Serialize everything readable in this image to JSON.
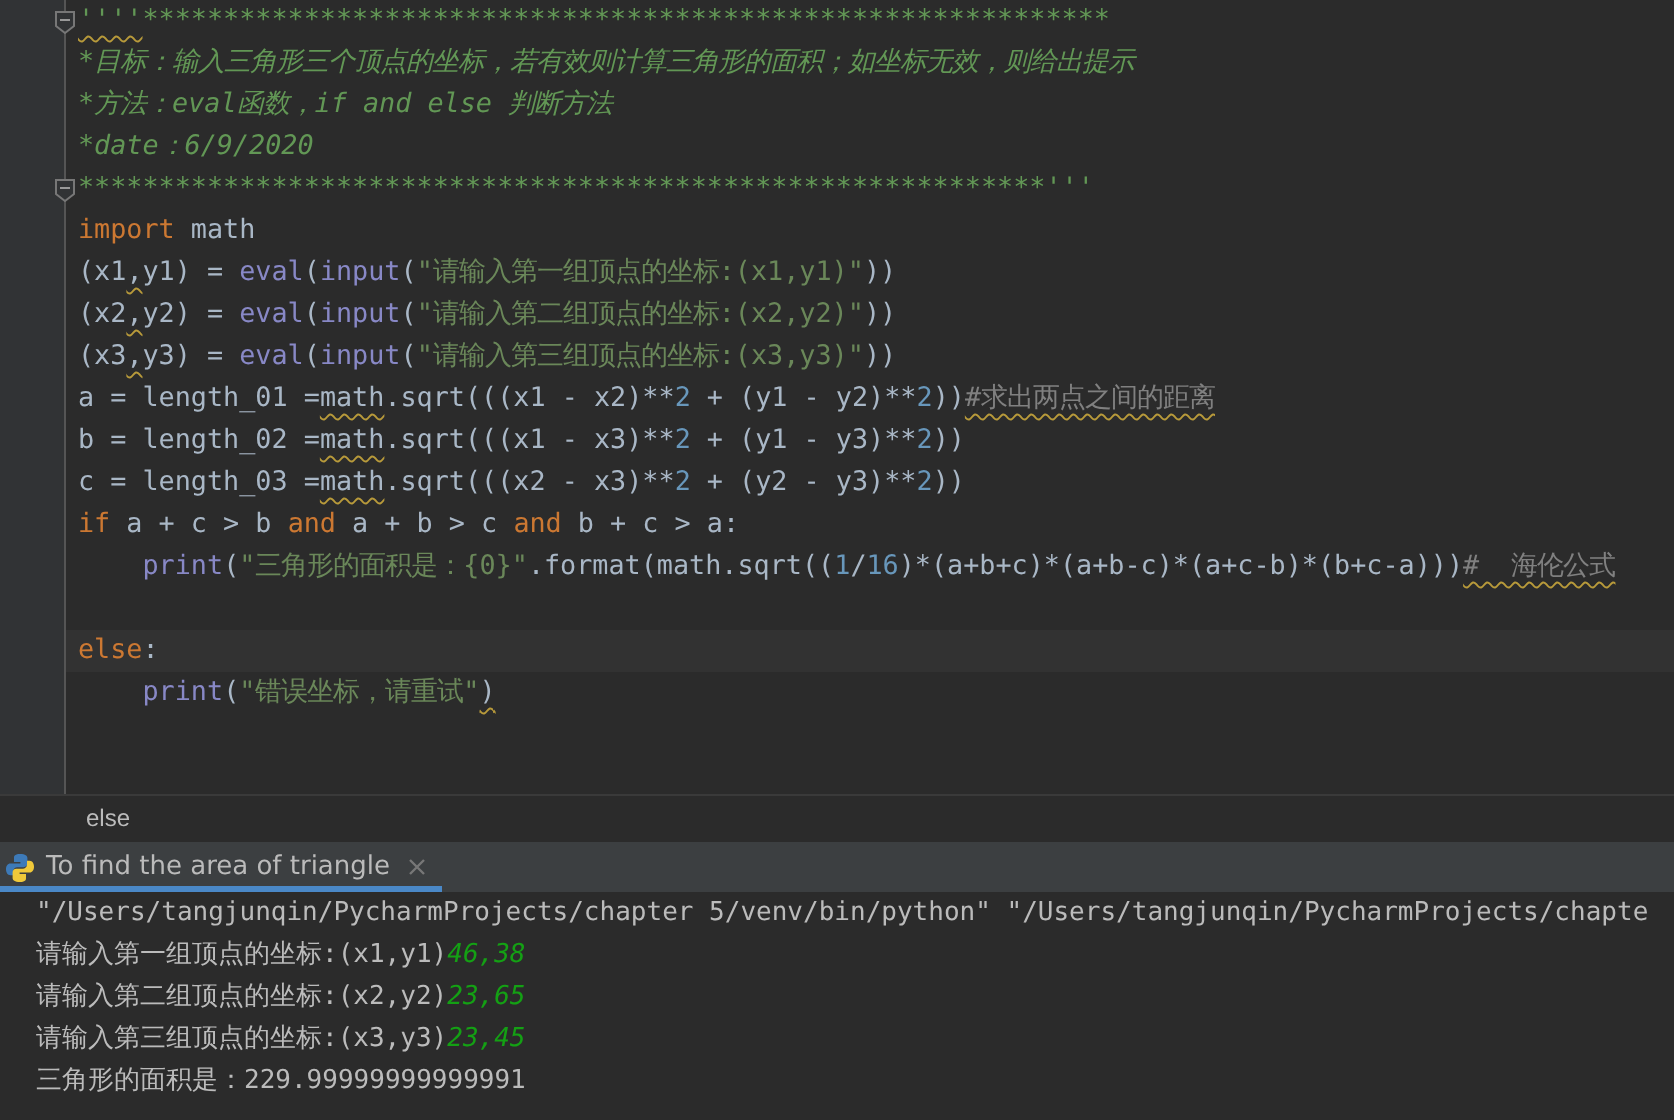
{
  "editor": {
    "lines": [
      {
        "fold": true,
        "tokens": [
          {
            "kind": "docstring",
            "text": "''''",
            "warned": true
          },
          {
            "kind": "docstring",
            "text": "************************************************************"
          }
        ]
      },
      {
        "tokens": [
          {
            "kind": "docstring",
            "text": "*目标：输入三角形三个顶点的坐标，若有效则计算三角形的面积；如坐标无效，则给出提示"
          }
        ]
      },
      {
        "tokens": [
          {
            "kind": "docstring",
            "text": "*方法：eval函数，if and else 判断方法"
          }
        ]
      },
      {
        "tokens": [
          {
            "kind": "docstring",
            "text": "*date：6/9/2020"
          }
        ]
      },
      {
        "fold": true,
        "tokens": [
          {
            "kind": "docstring",
            "text": "************************************************************'''"
          }
        ]
      },
      {
        "tokens": [
          {
            "kind": "keyword",
            "text": "import"
          },
          {
            "kind": "plain",
            "text": " math"
          }
        ]
      },
      {
        "tokens": [
          {
            "kind": "plain",
            "text": "(x1"
          },
          {
            "kind": "plain",
            "text": ",",
            "warned": true
          },
          {
            "kind": "plain",
            "text": "y1) = "
          },
          {
            "kind": "builtin",
            "text": "eval"
          },
          {
            "kind": "plain",
            "text": "("
          },
          {
            "kind": "builtin",
            "text": "input"
          },
          {
            "kind": "plain",
            "text": "("
          },
          {
            "kind": "string",
            "text": "\"请输入第一组顶点的坐标:(x1,y1)\""
          },
          {
            "kind": "plain",
            "text": "))"
          }
        ]
      },
      {
        "tokens": [
          {
            "kind": "plain",
            "text": "(x2"
          },
          {
            "kind": "plain",
            "text": ",",
            "warned": true
          },
          {
            "kind": "plain",
            "text": "y2) = "
          },
          {
            "kind": "builtin",
            "text": "eval"
          },
          {
            "kind": "plain",
            "text": "("
          },
          {
            "kind": "builtin",
            "text": "input"
          },
          {
            "kind": "plain",
            "text": "("
          },
          {
            "kind": "string",
            "text": "\"请输入第二组顶点的坐标:(x2,y2)\""
          },
          {
            "kind": "plain",
            "text": "))"
          }
        ]
      },
      {
        "tokens": [
          {
            "kind": "plain",
            "text": "(x3"
          },
          {
            "kind": "plain",
            "text": ",",
            "warned": true
          },
          {
            "kind": "plain",
            "text": "y3) = "
          },
          {
            "kind": "builtin",
            "text": "eval"
          },
          {
            "kind": "plain",
            "text": "("
          },
          {
            "kind": "builtin",
            "text": "input"
          },
          {
            "kind": "plain",
            "text": "("
          },
          {
            "kind": "string",
            "text": "\"请输入第三组顶点的坐标:(x3,y3)\""
          },
          {
            "kind": "plain",
            "text": "))"
          }
        ]
      },
      {
        "tokens": [
          {
            "kind": "plain",
            "text": "a = length_01 ="
          },
          {
            "kind": "plain",
            "text": "math",
            "warned": true
          },
          {
            "kind": "plain",
            "text": ".sqrt(((x1 - x2)**"
          },
          {
            "kind": "number",
            "text": "2"
          },
          {
            "kind": "plain",
            "text": " + (y1 - y2)**"
          },
          {
            "kind": "number",
            "text": "2"
          },
          {
            "kind": "plain",
            "text": "))"
          },
          {
            "kind": "comment",
            "text": "#求出两点之间的距离",
            "warned": true
          }
        ]
      },
      {
        "tokens": [
          {
            "kind": "plain",
            "text": "b = length_02 ="
          },
          {
            "kind": "plain",
            "text": "math",
            "warned": true
          },
          {
            "kind": "plain",
            "text": ".sqrt(((x1 - x3)**"
          },
          {
            "kind": "number",
            "text": "2"
          },
          {
            "kind": "plain",
            "text": " + (y1 - y3)**"
          },
          {
            "kind": "number",
            "text": "2"
          },
          {
            "kind": "plain",
            "text": "))"
          }
        ]
      },
      {
        "tokens": [
          {
            "kind": "plain",
            "text": "c = length_03 ="
          },
          {
            "kind": "plain",
            "text": "math",
            "warned": true
          },
          {
            "kind": "plain",
            "text": ".sqrt(((x2 - x3)**"
          },
          {
            "kind": "number",
            "text": "2"
          },
          {
            "kind": "plain",
            "text": " + (y2 - y3)**"
          },
          {
            "kind": "number",
            "text": "2"
          },
          {
            "kind": "plain",
            "text": "))"
          }
        ]
      },
      {
        "tokens": [
          {
            "kind": "keyword",
            "text": "if"
          },
          {
            "kind": "plain",
            "text": " a + c > b "
          },
          {
            "kind": "keyword",
            "text": "and"
          },
          {
            "kind": "plain",
            "text": " a + b > c "
          },
          {
            "kind": "keyword",
            "text": "and"
          },
          {
            "kind": "plain",
            "text": " b + c > a:"
          }
        ]
      },
      {
        "blank_after": true,
        "tokens": [
          {
            "kind": "builtin",
            "text": "    print"
          },
          {
            "kind": "plain",
            "text": "("
          },
          {
            "kind": "string",
            "text": "\"三角形的面积是：{0}\""
          },
          {
            "kind": "plain",
            "text": ".format(math.sqrt(("
          },
          {
            "kind": "number",
            "text": "1"
          },
          {
            "kind": "plain",
            "text": "/"
          },
          {
            "kind": "number",
            "text": "16"
          },
          {
            "kind": "plain",
            "text": ")*(a+b+c)*(a+b-c)*(a+c-b)*(b+c-a)))"
          },
          {
            "kind": "comment",
            "text": "#  海伦公式",
            "warned": true
          }
        ]
      },
      {
        "current": true,
        "tokens": [
          {
            "kind": "keyword",
            "text": "else"
          },
          {
            "kind": "plain",
            "text": ":"
          }
        ]
      },
      {
        "tokens": [
          {
            "kind": "builtin",
            "text": "    print"
          },
          {
            "kind": "plain",
            "text": "("
          },
          {
            "kind": "string",
            "text": "\"错误坐标，请重试\""
          },
          {
            "kind": "plain",
            "text": ")",
            "warned": true
          }
        ]
      }
    ]
  },
  "breadcrumb": "else",
  "run_tab": {
    "label": "To find the area of triangle",
    "selected": true
  },
  "console": [
    [
      {
        "kind": "output",
        "text": "\"/Users/tangjunqin/PycharmProjects/chapter 5/venv/bin/python\" \"/Users/tangjunqin/PycharmProjects/chapte"
      }
    ],
    [
      {
        "kind": "output",
        "text": "请输入第一组顶点的坐标:(x1,y1)"
      },
      {
        "kind": "input",
        "text": "46,38"
      }
    ],
    [
      {
        "kind": "output",
        "text": "请输入第二组顶点的坐标:(x2,y2)"
      },
      {
        "kind": "input",
        "text": "23,65"
      }
    ],
    [
      {
        "kind": "output",
        "text": "请输入第三组顶点的坐标:(x3,y3)"
      },
      {
        "kind": "input",
        "text": "23,45"
      }
    ],
    [
      {
        "kind": "output",
        "text": "三角形的面积是：229.99999999999991"
      }
    ]
  ]
}
